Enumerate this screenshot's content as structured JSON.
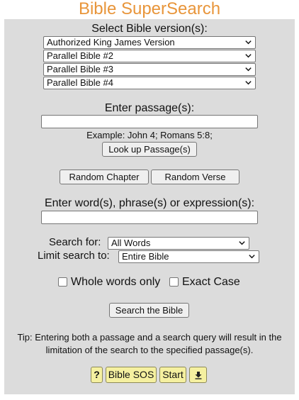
{
  "header": {
    "title": "Bible SuperSearch"
  },
  "versions": {
    "label": "Select Bible version(s):",
    "selects": [
      "Authorized King James Version",
      "Parallel Bible #2",
      "Parallel Bible #3",
      "Parallel Bible #4"
    ]
  },
  "passage": {
    "label": "Enter passage(s):",
    "value": "",
    "example": "Example: John 4; Romans 5:8;",
    "lookup_button": "Look up Passage(s)"
  },
  "random": {
    "chapter_button": "Random Chapter",
    "verse_button": "Random Verse"
  },
  "search": {
    "label": "Enter word(s), phrase(s) or expression(s):",
    "value": "",
    "search_for_label": "Search for:",
    "search_for_value": "All Words",
    "limit_label": "Limit search to:",
    "limit_value": "Entire Bible",
    "whole_words_label": "Whole words only",
    "exact_case_label": "Exact Case",
    "submit_button": "Search the Bible"
  },
  "tip": {
    "line1": "Tip: Entering both a passage and a search query will result in the",
    "line2": "limitation of the search to the specified passage(s)."
  },
  "footer": {
    "help_button": "?",
    "sos_button": "Bible SOS",
    "start_button": "Start",
    "download_icon": "download-icon"
  },
  "colors": {
    "title": "#e8953a",
    "panel": "#dcdcdc",
    "footer_button": "#f5f0a0"
  }
}
